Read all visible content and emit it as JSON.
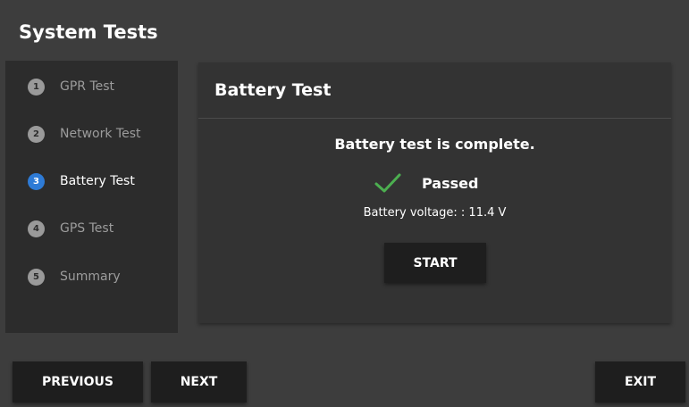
{
  "app": {
    "title": "System Tests"
  },
  "steps": [
    {
      "number": "1",
      "label": "GPR Test",
      "active": false
    },
    {
      "number": "2",
      "label": "Network Test",
      "active": false
    },
    {
      "number": "3",
      "label": "Battery Test",
      "active": true
    },
    {
      "number": "4",
      "label": "GPS Test",
      "active": false
    },
    {
      "number": "5",
      "label": "Summary",
      "active": false
    }
  ],
  "panel": {
    "title": "Battery Test",
    "status_message": "Battery test is complete.",
    "result_icon": "check-icon",
    "result_label": "Passed",
    "voltage_text": "Battery voltage: : 11.4 V",
    "start_label": "START"
  },
  "footer": {
    "previous_label": "PREVIOUS",
    "next_label": "NEXT",
    "exit_label": "EXIT"
  },
  "colors": {
    "background": "#3d3d3d",
    "sidebar": "#2c2c2c",
    "panel": "#333333",
    "button": "#1e1e1e",
    "active_step": "#2e7bd6",
    "inactive_step": "#9a9a9a",
    "check": "#4caf50"
  }
}
